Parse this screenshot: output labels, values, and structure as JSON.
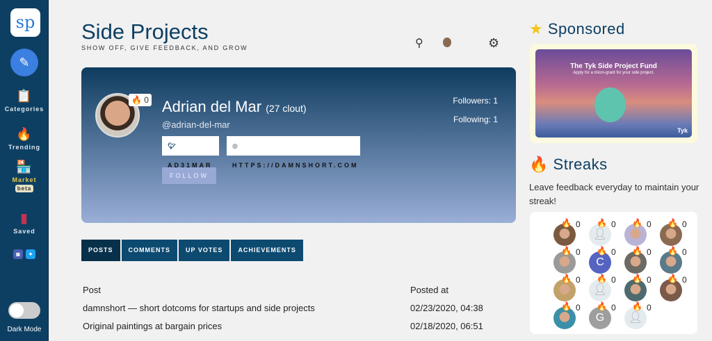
{
  "sidebar": {
    "logo": "sp",
    "items": [
      {
        "label": "Categories",
        "icon": "📋"
      },
      {
        "label": "Trending",
        "icon": "🔥"
      },
      {
        "label": "Market",
        "icon": "🏪",
        "badge": "beta"
      },
      {
        "label": "Saved",
        "icon": "🔖"
      }
    ],
    "dark_mode_label": "Dark Mode",
    "dark_mode": false
  },
  "header": {
    "title": "Side Projects",
    "subtitle": "SHOW OFF, GIVE FEEDBACK, AND GROW"
  },
  "profile": {
    "name": "Adrian del Mar",
    "clout": "(27 clout)",
    "handle": "@adrian-del-mar",
    "streak": "0",
    "twitter": "AD31MAR",
    "website": "HTTPS://DAMNSHORT.COM",
    "follow_label": "FOLLOW",
    "followers": "Followers: 1",
    "following": "Following: 1"
  },
  "tabs": [
    "POSTS",
    "COMMENTS",
    "UP VOTES",
    "ACHIEVEMENTS"
  ],
  "posts": {
    "headers": [
      "Post",
      "Posted at"
    ],
    "rows": [
      {
        "title": "damnshort — short dotcoms for startups and side projects",
        "date": "02/23/2020, 04:38"
      },
      {
        "title": "Original paintings at bargain prices",
        "date": "02/18/2020, 06:51"
      }
    ]
  },
  "sponsored": {
    "heading": "Sponsored",
    "ad_title": "The Tyk Side Project Fund",
    "ad_subtitle": "Apply for a micro-grant for your side project.",
    "ad_brand": "Tyk"
  },
  "streaks": {
    "heading": "Streaks",
    "description": "Leave feedback everyday to maintain your streak!",
    "users": [
      {
        "type": "photo",
        "color": "#7a5a3e",
        "count": "0"
      },
      {
        "type": "placeholder",
        "count": "0"
      },
      {
        "type": "photo",
        "color": "#b9b3d6",
        "count": "0"
      },
      {
        "type": "photo",
        "color": "#8b6a52",
        "count": "0"
      },
      {
        "type": "photo",
        "color": "#9a9a9a",
        "count": "0"
      },
      {
        "type": "letter",
        "letter": "C",
        "color": "#5563c1",
        "count": "0"
      },
      {
        "type": "photo",
        "color": "#6b6a63",
        "count": "0"
      },
      {
        "type": "photo",
        "color": "#5a7a8a",
        "count": "0"
      },
      {
        "type": "photo",
        "color": "#c2a26a",
        "count": "0"
      },
      {
        "type": "placeholder",
        "count": "0"
      },
      {
        "type": "photo",
        "color": "#4f6a6e",
        "count": "0"
      },
      {
        "type": "photo",
        "color": "#7b5a4a",
        "count": "0"
      },
      {
        "type": "photo",
        "color": "#3c8fa8",
        "count": "0"
      },
      {
        "type": "letter",
        "letter": "G",
        "color": "#9e9e9e",
        "count": "0"
      },
      {
        "type": "placeholder",
        "count": "0"
      }
    ]
  }
}
